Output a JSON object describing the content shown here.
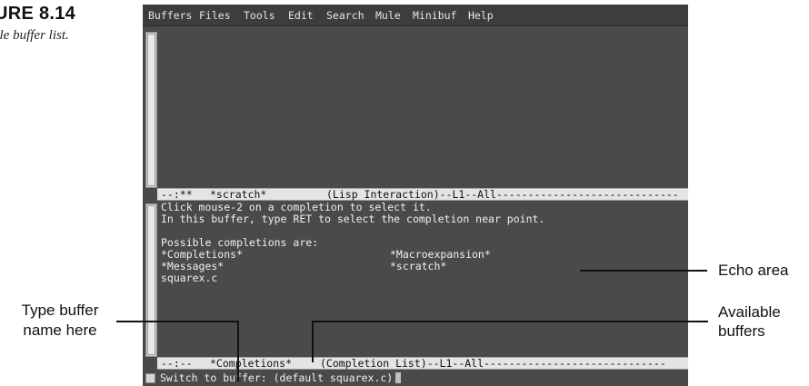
{
  "figure": {
    "label": "URE 8.14",
    "caption": "ple buffer list."
  },
  "menubar": {
    "items": [
      "Buffers",
      "Files",
      "Tools",
      "Edit",
      "Search",
      "Mule",
      "Minibuf",
      "Help"
    ]
  },
  "scratch_modeline": {
    "status": "--:**",
    "buffer": "*scratch*",
    "mode": "(Lisp Interaction)--L1--All-----------------------------"
  },
  "completions_text": {
    "line1": "Click mouse-2 on a completion to select it.",
    "line2": "In this buffer, type RET to select the completion near point.",
    "line3": "Possible completions are:",
    "col1": [
      "*Completions*",
      "*Messages*",
      "squarex.c"
    ],
    "col2": [
      "*Macroexpansion*",
      "*scratch*"
    ]
  },
  "completions_modeline": {
    "status": "--:--",
    "buffer": "*Completions*",
    "mode": "(Completion List)--L1--All-----------------------------"
  },
  "minibuffer": {
    "prompt": "Switch to buffer: (default squarex.c)"
  },
  "callouts": {
    "echo_area": "Echo area",
    "type_buffer_line1": "Type buffer",
    "type_buffer_line2": "name here",
    "available_line1": "Available",
    "available_line2": "buffers"
  }
}
